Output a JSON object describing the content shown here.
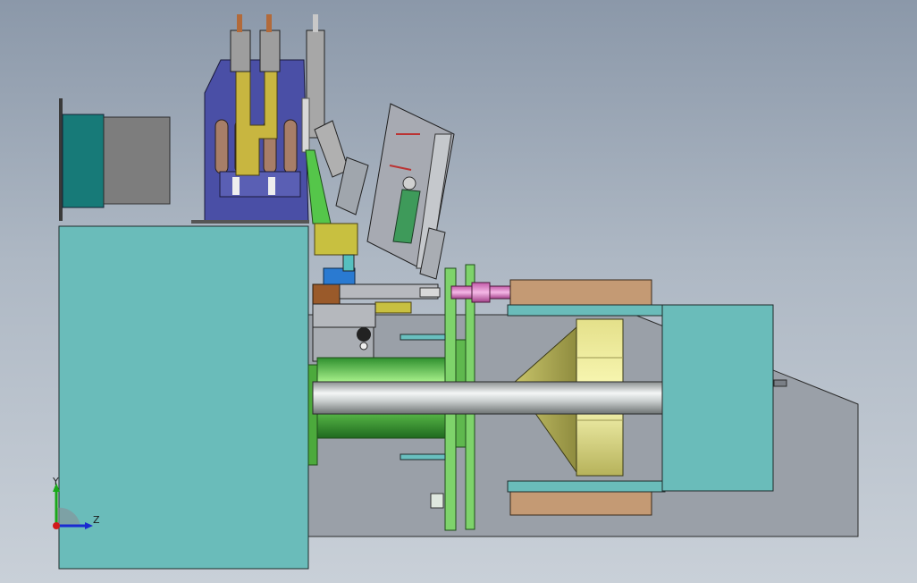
{
  "triad": {
    "y_label": "Y",
    "z_label": "Z"
  }
}
